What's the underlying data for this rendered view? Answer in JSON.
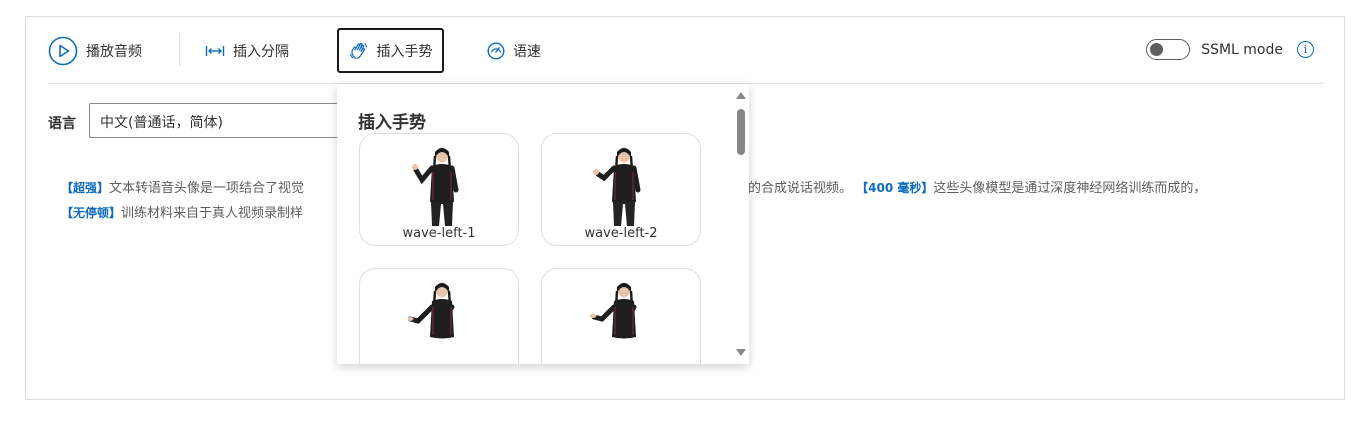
{
  "toolbar": {
    "play_label": "播放音频",
    "break_label": "插入分隔",
    "gesture_label": "插入手势",
    "speed_label": "语速",
    "ssml_label": "SSML mode"
  },
  "language": {
    "label": "语言",
    "value": "中文(普通话，简体)"
  },
  "content": {
    "tag1": "【超强】",
    "text1": "文本转语音头像是一项结合了视觉",
    "text1b": "的合成说话视频。",
    "tag2": "【400 毫秒】",
    "text2": "这些头像模型是通过深度神经网络训练而成的，",
    "tag3": "【无停顿】",
    "text3": "训练材料来自于真人视频录制样"
  },
  "gesture_panel": {
    "title": "插入手势",
    "items": [
      {
        "caption": "wave-left-1"
      },
      {
        "caption": "wave-left-2"
      },
      {
        "caption": ""
      },
      {
        "caption": ""
      }
    ]
  },
  "colors": {
    "accent": "#0f6cbd",
    "text": "#323130",
    "border": "#e1dfdd"
  }
}
